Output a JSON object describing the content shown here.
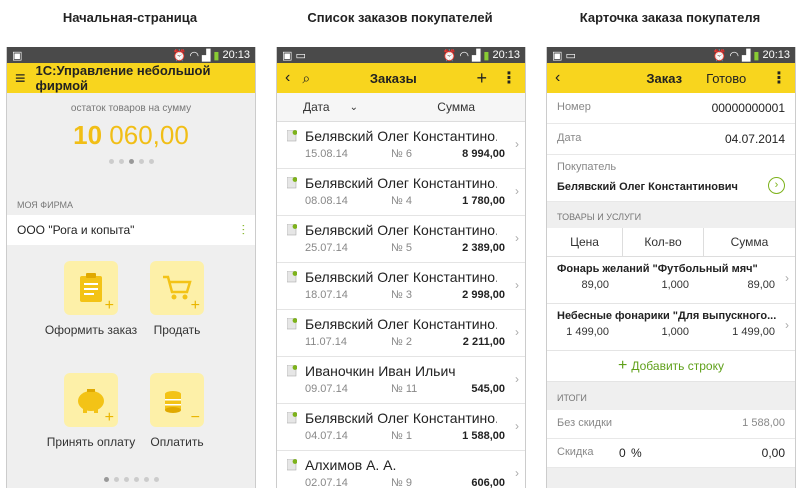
{
  "captions": [
    "Начальная-страница",
    "Список заказов покупателей",
    "Карточка заказа покупателя"
  ],
  "statusbar": {
    "time": "20:13"
  },
  "home": {
    "app_title": "1С:Управление небольшой фирмой",
    "balance_label": "остаток товаров на сумму",
    "balance_int": "10",
    "balance_rest": " 060,00",
    "section": "МОЯ ФИРМА",
    "firm": "ООО \"Рога и копыта\"",
    "tiles": [
      "Оформить заказ",
      "Продать",
      "Принять оплату",
      "Оплатить"
    ]
  },
  "orders": {
    "title": "Заказы",
    "col_date": "Дата",
    "col_sum": "Сумма",
    "items": [
      {
        "name": "Белявский Олег Константино...",
        "date": "15.08.14",
        "no": "№ 6",
        "amount": "8 994,00"
      },
      {
        "name": "Белявский Олег Константино...",
        "date": "08.08.14",
        "no": "№ 4",
        "amount": "1 780,00"
      },
      {
        "name": "Белявский Олег Константино...",
        "date": "25.07.14",
        "no": "№ 5",
        "amount": "2 389,00"
      },
      {
        "name": "Белявский Олег Константино...",
        "date": "18.07.14",
        "no": "№ 3",
        "amount": "2 998,00"
      },
      {
        "name": "Белявский Олег Константино...",
        "date": "11.07.14",
        "no": "№ 2",
        "amount": "2 211,00"
      },
      {
        "name": "Иваночкин Иван Ильич",
        "date": "09.07.14",
        "no": "№ 11",
        "amount": "545,00"
      },
      {
        "name": "Белявский Олег Константино...",
        "date": "04.07.14",
        "no": "№ 1",
        "amount": "1 588,00"
      },
      {
        "name": "Алхимов А. А.",
        "date": "02.07.14",
        "no": "№ 9",
        "amount": "606,00"
      }
    ]
  },
  "card": {
    "title": "Заказ",
    "done": "Готово",
    "number_label": "Номер",
    "number": "00000000001",
    "date_label": "Дата",
    "date": "04.07.2014",
    "buyer_label": "Покупатель",
    "buyer": "Белявский Олег Константинович",
    "goods_section": "ТОВАРЫ И УСЛУГИ",
    "col_price": "Цена",
    "col_qty": "Кол-во",
    "col_sum": "Сумма",
    "rows": [
      {
        "name": "Фонарь желаний \"Футбольный мяч\"",
        "price": "89,00",
        "qty": "1,000",
        "sum": "89,00"
      },
      {
        "name": "Небесные фонарики \"Для выпускного...",
        "price": "1 499,00",
        "qty": "1,000",
        "sum": "1 499,00"
      }
    ],
    "add_row": "Добавить строку",
    "totals_section": "ИТОГИ",
    "no_discount_label": "Без скидки",
    "no_discount": "1 588,00",
    "discount_label": "Скидка",
    "discount_pct": "0",
    "pct_sign": "%",
    "discount": "0,00"
  }
}
